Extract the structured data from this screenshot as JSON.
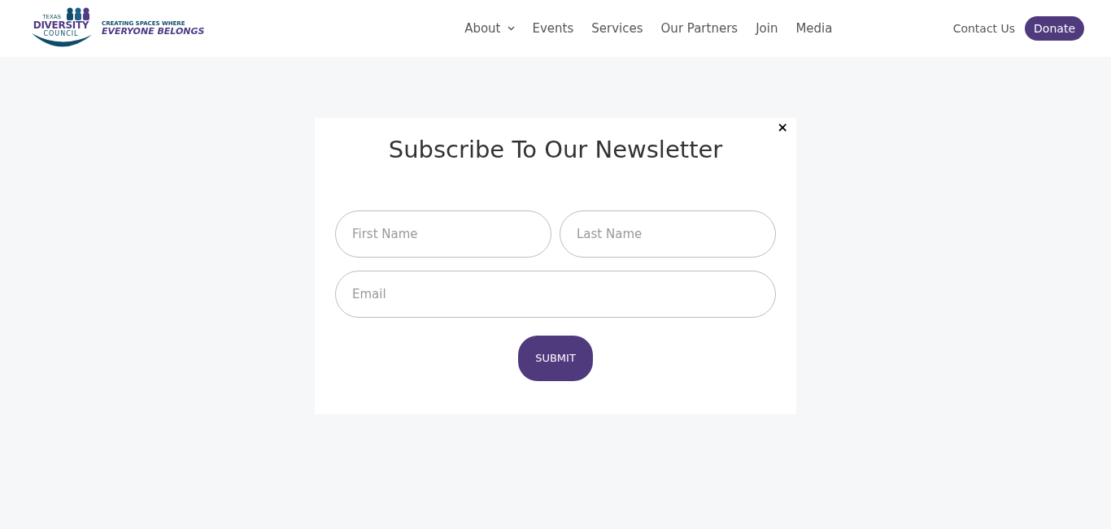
{
  "logo": {
    "top": "TEXAS",
    "middle": "DIVERSITY",
    "bottom": "COUNCIL",
    "tagline_top": "CREATING SPACES WHERE",
    "tagline_bottom": "EVERYONE BELONGS"
  },
  "nav": [
    {
      "label": "About",
      "kind": "dropdown"
    },
    {
      "label": "Events",
      "kind": "link"
    },
    {
      "label": "Services",
      "kind": "link"
    },
    {
      "label": "Our Partners",
      "kind": "link"
    },
    {
      "label": "Join",
      "kind": "link"
    },
    {
      "label": "Media",
      "kind": "link"
    }
  ],
  "contact": "Contact Us",
  "donate": "Donate",
  "modal": {
    "close": "×",
    "title": "Subscribe To Our Newsletter",
    "first_name": {
      "placeholder": "First Name"
    },
    "last_name": {
      "placeholder": "Last Name"
    },
    "email": {
      "placeholder": "Email"
    },
    "submit": "SUBMIT"
  }
}
